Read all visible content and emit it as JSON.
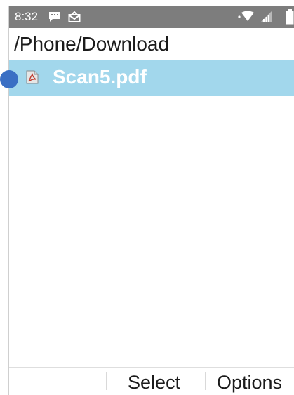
{
  "status_bar": {
    "time": "8:32",
    "icons": [
      "message-icon",
      "mail-icon",
      "wifi-icon",
      "signal-icon",
      "battery-icon"
    ]
  },
  "path": "/Phone/Download",
  "files": [
    {
      "name": "Scan5.pdf",
      "icon": "pdf-file-icon",
      "selected": true
    }
  ],
  "softkeys": {
    "left": "",
    "center": "Select",
    "right": "Options"
  },
  "colors": {
    "status_bar_bg": "#7d7d7d",
    "selection_bg": "#a2d7ec",
    "cursor": "#3a6fc4"
  }
}
